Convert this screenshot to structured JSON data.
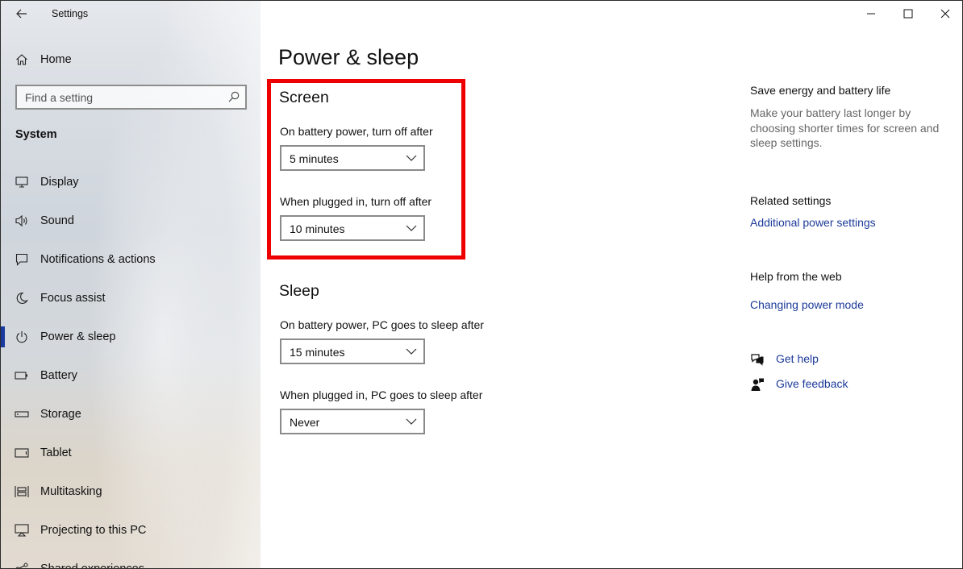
{
  "window": {
    "title": "Settings"
  },
  "sidebar": {
    "home_label": "Home",
    "search": {
      "placeholder": "Find a setting",
      "value": ""
    },
    "section_title": "System",
    "items": [
      {
        "label": "Display",
        "icon": "display-icon",
        "active": false
      },
      {
        "label": "Sound",
        "icon": "sound-icon",
        "active": false
      },
      {
        "label": "Notifications & actions",
        "icon": "notifications-icon",
        "active": false
      },
      {
        "label": "Focus assist",
        "icon": "moon-icon",
        "active": false
      },
      {
        "label": "Power & sleep",
        "icon": "power-icon",
        "active": true
      },
      {
        "label": "Battery",
        "icon": "battery-icon",
        "active": false
      },
      {
        "label": "Storage",
        "icon": "storage-icon",
        "active": false
      },
      {
        "label": "Tablet",
        "icon": "tablet-icon",
        "active": false
      },
      {
        "label": "Multitasking",
        "icon": "multitasking-icon",
        "active": false
      },
      {
        "label": "Projecting to this PC",
        "icon": "projecting-icon",
        "active": false
      },
      {
        "label": "Shared experiences",
        "icon": "shared-experiences-icon",
        "active": false
      }
    ]
  },
  "main": {
    "title": "Power & sleep",
    "screen": {
      "title": "Screen",
      "battery_label": "On battery power, turn off after",
      "battery_value": "5 minutes",
      "plugged_label": "When plugged in, turn off after",
      "plugged_value": "10 minutes"
    },
    "sleep": {
      "title": "Sleep",
      "battery_label": "On battery power, PC goes to sleep after",
      "battery_value": "15 minutes",
      "plugged_label": "When plugged in, PC goes to sleep after",
      "plugged_value": "Never"
    }
  },
  "aside": {
    "save_energy_title": "Save energy and battery life",
    "save_energy_desc": "Make your battery last longer by choosing shorter times for screen and sleep settings.",
    "related_title": "Related settings",
    "related_link": "Additional power settings",
    "help_web_title": "Help from the web",
    "help_web_link": "Changing power mode",
    "get_help": "Get help",
    "give_feedback": "Give feedback"
  },
  "colors": {
    "accent": "#1b3a9e",
    "link": "#1c3a9a",
    "highlight": "#ee0000"
  }
}
